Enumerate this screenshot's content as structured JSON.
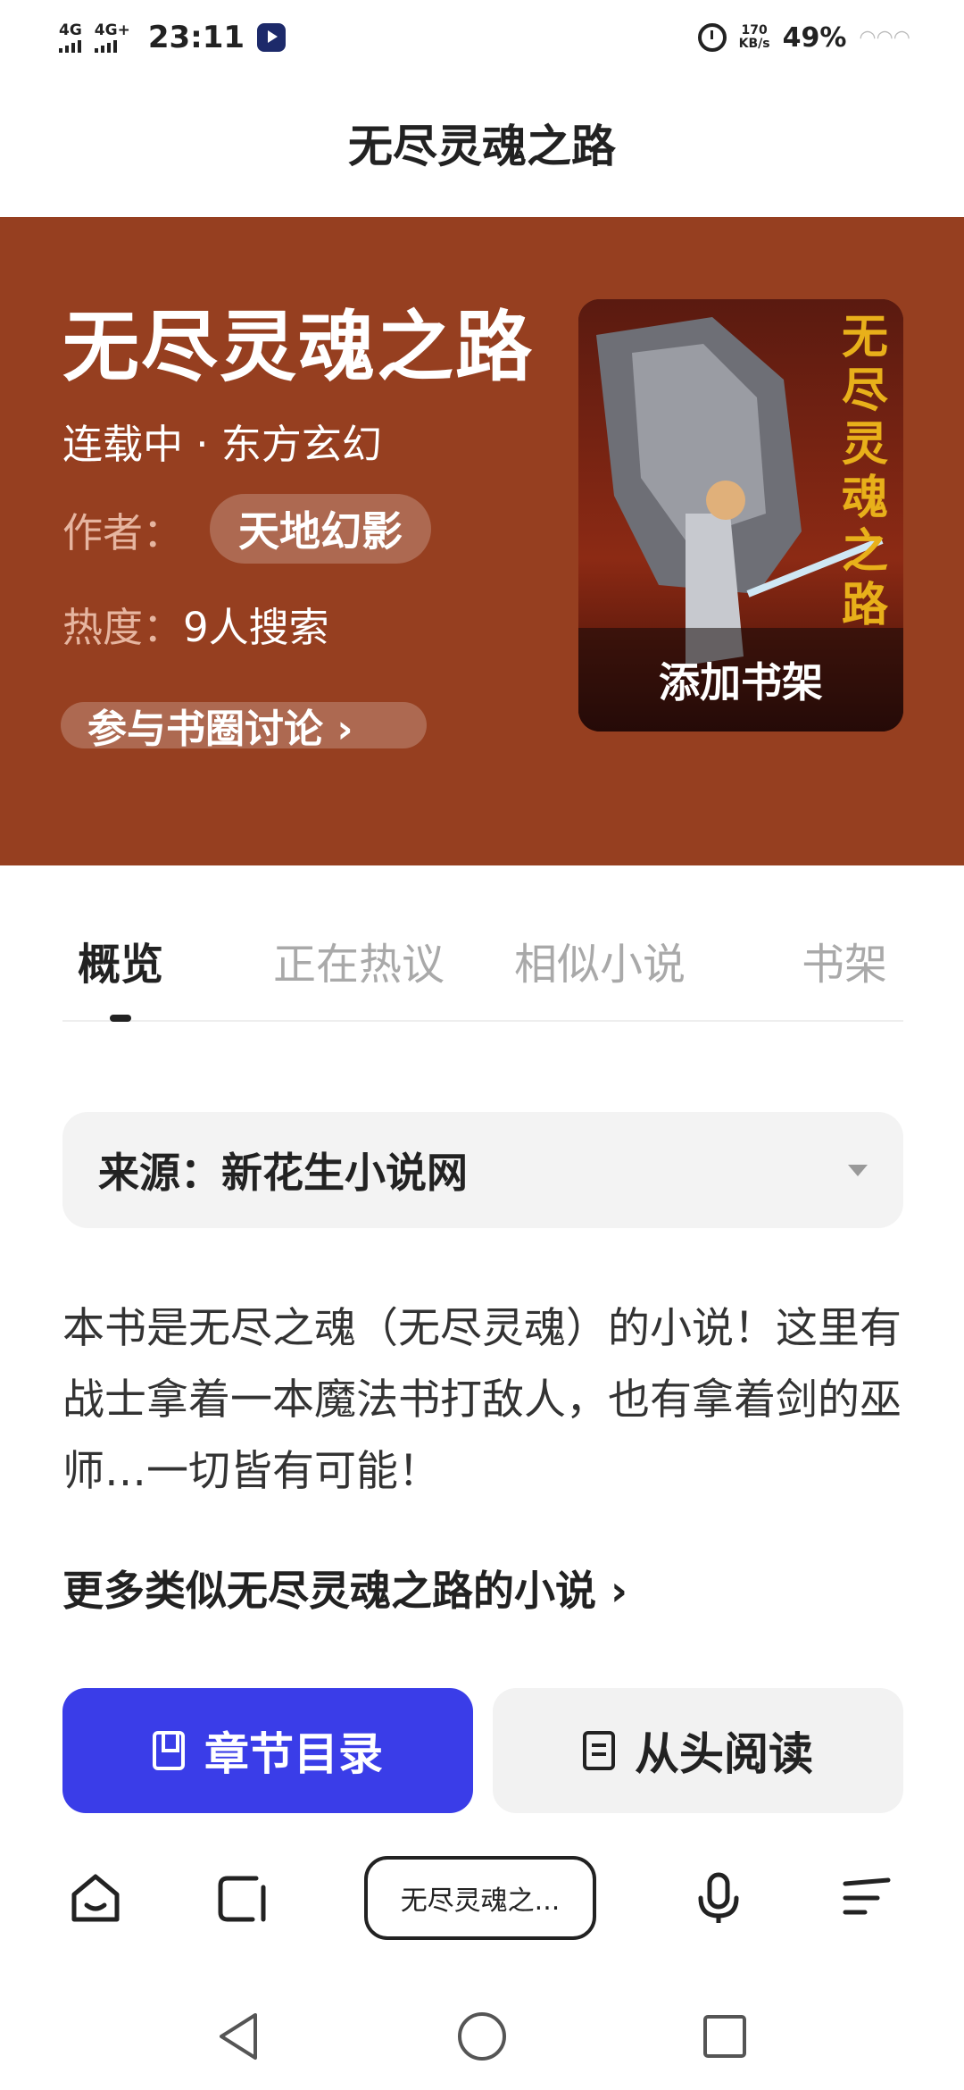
{
  "status_bar": {
    "signal1": "4G",
    "signal2": "4G+",
    "time": "23:11",
    "net_speed_value": "170",
    "net_speed_unit": "KB/s",
    "battery": "49%"
  },
  "header": {
    "title": "无尽灵魂之路"
  },
  "hero": {
    "title": "无尽灵魂之路",
    "meta": "连载中 · 东方玄幻",
    "author_label": "作者：",
    "author_name": "天地幻影",
    "heat_label": "热度：",
    "heat_value": "9人搜索",
    "circle_link": "参与书圈讨论 ›",
    "add_to_shelf": "添加书架",
    "cover_text": "无尽灵魂之路",
    "bg_color": "#963f20"
  },
  "tabs": [
    {
      "label": "概览",
      "active": true
    },
    {
      "label": "正在热议",
      "active": false
    },
    {
      "label": "相似小说",
      "active": false
    },
    {
      "label": "书架",
      "active": false
    }
  ],
  "source": {
    "label": "来源：新花生小说网"
  },
  "description": "本书是无尽之魂（无尽灵魂）的小说！这里有战士拿着一本魔法书打敌人，也有拿着剑的巫师…一切皆有可能！",
  "more_link": "更多类似无尽灵魂之路的小说 ›",
  "buttons": {
    "catalog": "章节目录",
    "read_from_start": "从头阅读",
    "catalog_color": "#3a3de8"
  },
  "browser_nav": {
    "current_tab": "无尽灵魂之..."
  },
  "icons": [
    "home-icon",
    "tabs-icon",
    "mic-icon",
    "menu-icon",
    "back-icon",
    "home-circle-icon",
    "recents-icon",
    "bookmark-icon",
    "document-icon",
    "alarm-icon",
    "dropdown-caret-icon"
  ]
}
